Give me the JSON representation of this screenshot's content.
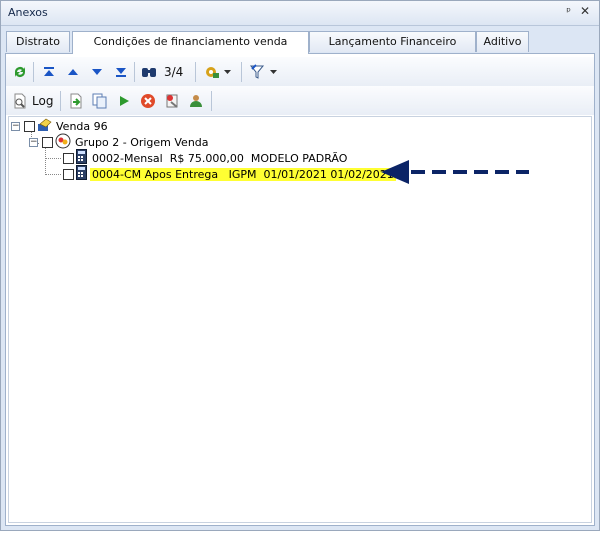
{
  "window": {
    "title": "Anexos",
    "pin_glyph": "ᵖ",
    "close_glyph": "✕"
  },
  "tabs": [
    {
      "label": "Distrato",
      "active": false
    },
    {
      "label": "Condições de financiamento venda",
      "active": true
    },
    {
      "label": "Lançamento Financeiro",
      "active": false
    },
    {
      "label": "Aditivo",
      "active": false
    }
  ],
  "toolbar1": {
    "icons": [
      "refresh-icon",
      "first-icon",
      "previous-icon",
      "next-icon",
      "last-icon",
      "binoculars-icon",
      "tools-dropdown-icon",
      "filter-dropdown-icon"
    ],
    "record_counter": "3/4"
  },
  "toolbar2": {
    "log_label": "Log",
    "icons": [
      "log-icon",
      "export-icon",
      "copy-icon",
      "play-icon",
      "cancel-icon",
      "attach-icon",
      "user-icon"
    ]
  },
  "tree": {
    "root": {
      "label": "Venda 96"
    },
    "group": {
      "label": "Grupo 2 - Origem Venda"
    },
    "items": [
      {
        "label": "0002-Mensal  R$ 75.000,00  MODELO PADRÃO",
        "highlighted": false
      },
      {
        "label": "0004-CM Apos Entrega   IGPM  01/01/2021 01/02/2021",
        "highlighted": true
      }
    ]
  },
  "colors": {
    "highlight": "#ffff33",
    "arrow": "#0b2466",
    "accent_blue": "#1a55c5"
  }
}
